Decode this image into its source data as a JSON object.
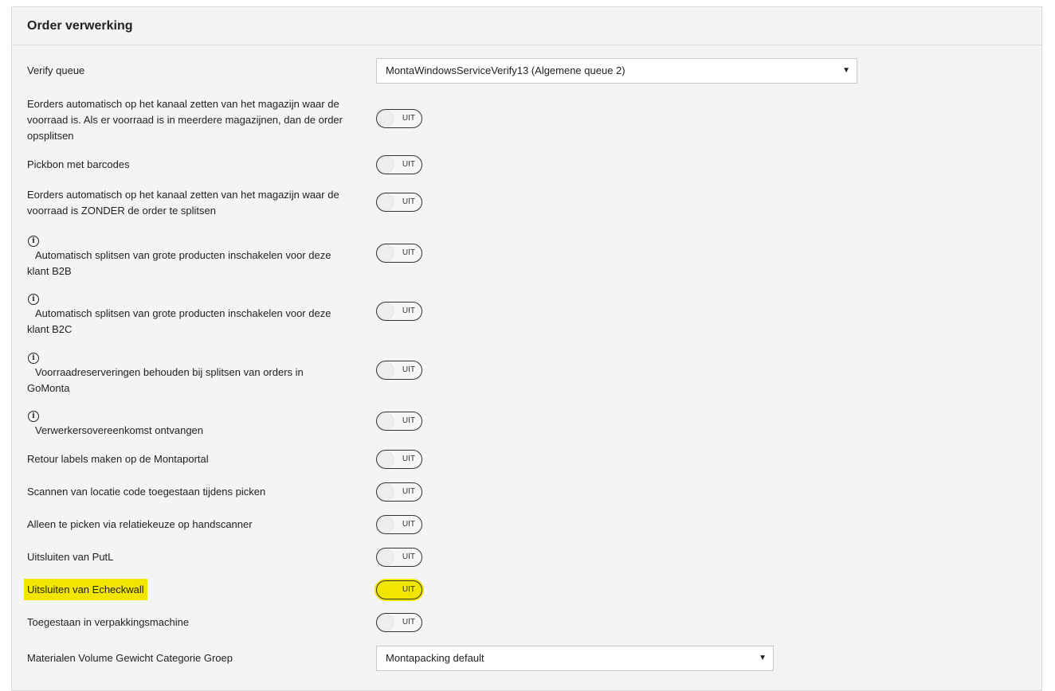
{
  "panel": {
    "title": "Order verwerking"
  },
  "verify_queue": {
    "label": "Verify queue",
    "value": "MontaWindowsServiceVerify13 (Algemene queue 2)"
  },
  "settings": [
    {
      "label": "Eorders automatisch op het kanaal zetten van het magazijn waar de voorraad is. Als er voorraad is in meerdere magazijnen, dan de order opsplitsen",
      "state": "UIT"
    },
    {
      "label": "Pickbon met barcodes",
      "state": "UIT"
    },
    {
      "label": "Eorders automatisch op het kanaal zetten van het magazijn waar de voorraad is ZONDER de order te splitsen",
      "state": "UIT"
    },
    {
      "label": "Automatisch splitsen van grote producten inschakelen voor deze klant B2B",
      "state": "UIT",
      "info": "i"
    },
    {
      "label": "Automatisch splitsen van grote producten inschakelen voor deze klant B2C",
      "state": "UIT",
      "info": "i"
    },
    {
      "label": "Voorraadreserveringen behouden bij splitsen van orders in GoMonta",
      "state": "UIT",
      "info": "i"
    },
    {
      "label": "Verwerkersovereenkomst ontvangen",
      "state": "UIT",
      "info": "i"
    },
    {
      "label": "Retour labels maken op de Montaportal",
      "state": "UIT"
    },
    {
      "label": "Scannen van locatie code toegestaan tijdens picken",
      "state": "UIT"
    },
    {
      "label": "Alleen te picken via relatiekeuze op handscanner",
      "state": "UIT"
    },
    {
      "label": "Uitsluiten van PutL",
      "state": "UIT"
    },
    {
      "label": "Uitsluiten van Echeckwall",
      "state": "UIT",
      "highlight_color": "#f2e600"
    },
    {
      "label": "Toegestaan in verpakkingsmachine",
      "state": "UIT"
    }
  ],
  "materials_group": {
    "label": "Materialen Volume Gewicht Categorie Groep",
    "value": "Montapacking default"
  },
  "icons": {
    "info": "info-circle-icon",
    "caret": "▼"
  }
}
